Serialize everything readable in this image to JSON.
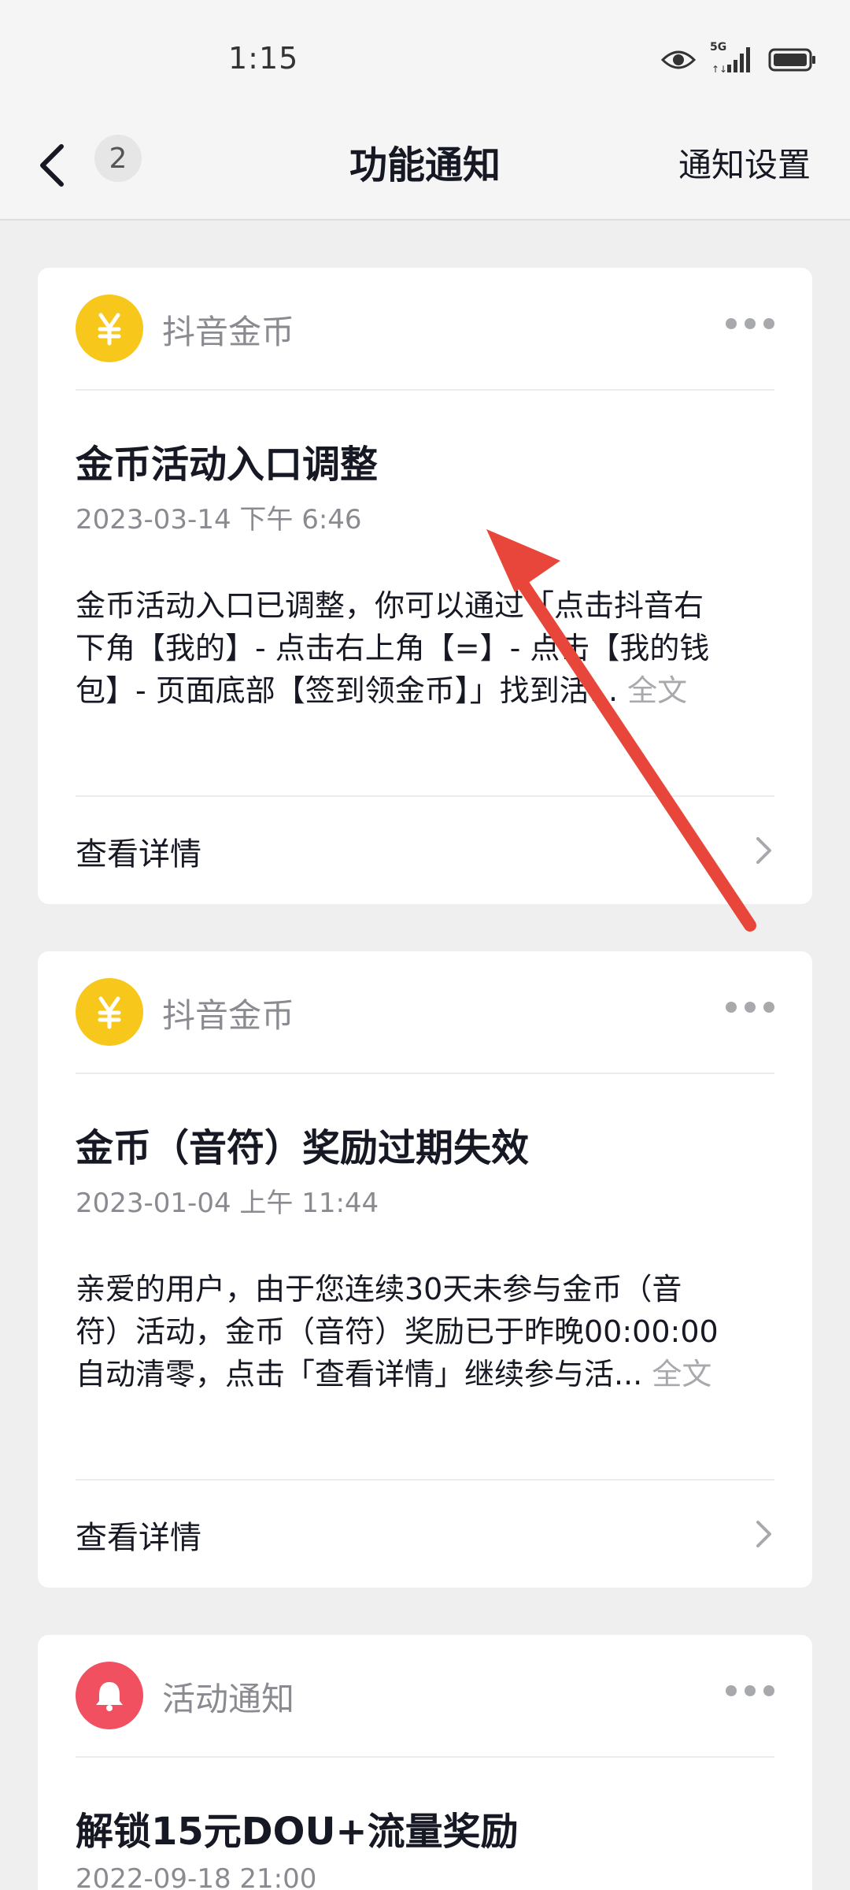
{
  "status_bar": {
    "time": "1:15",
    "network": "5G"
  },
  "header": {
    "back_icon": "chevron-left-icon",
    "unread_count": "2",
    "title": "功能通知",
    "settings_label": "通知设置"
  },
  "colors": {
    "coin_yellow": "#f8c71c",
    "bell_red": "#f05060",
    "annotation_red": "#e8463a"
  },
  "notifications": [
    {
      "source": "抖音金币",
      "icon": "yuan-coin-icon",
      "title": "金币活动入口调整",
      "time": "2023-03-14 下午 6:46",
      "body_lines": [
        "金币活动入口已调整，你可以通过「点击抖音右",
        "下角【我的】- 点击右上角【=】- 点击【我的钱",
        "包】- 页面底部【签到领金币】」找到活..."
      ],
      "fulltext_label": "全文",
      "footer_label": "查看详情"
    },
    {
      "source": "抖音金币",
      "icon": "yuan-coin-icon",
      "title": "金币（音符）奖励过期失效",
      "time": "2023-01-04 上午 11:44",
      "body_lines": [
        "亲爱的用户，由于您连续30天未参与金币（音",
        "符）活动，金币（音符）奖励已于昨晚00:00:00",
        "自动清零，点击「查看详情」继续参与活..."
      ],
      "fulltext_label": "全文",
      "footer_label": "查看详情"
    },
    {
      "source": "活动通知",
      "icon": "bell-icon",
      "title": "解锁15元DOU+流量奖励",
      "time": "2022-09-18 21:00"
    }
  ]
}
